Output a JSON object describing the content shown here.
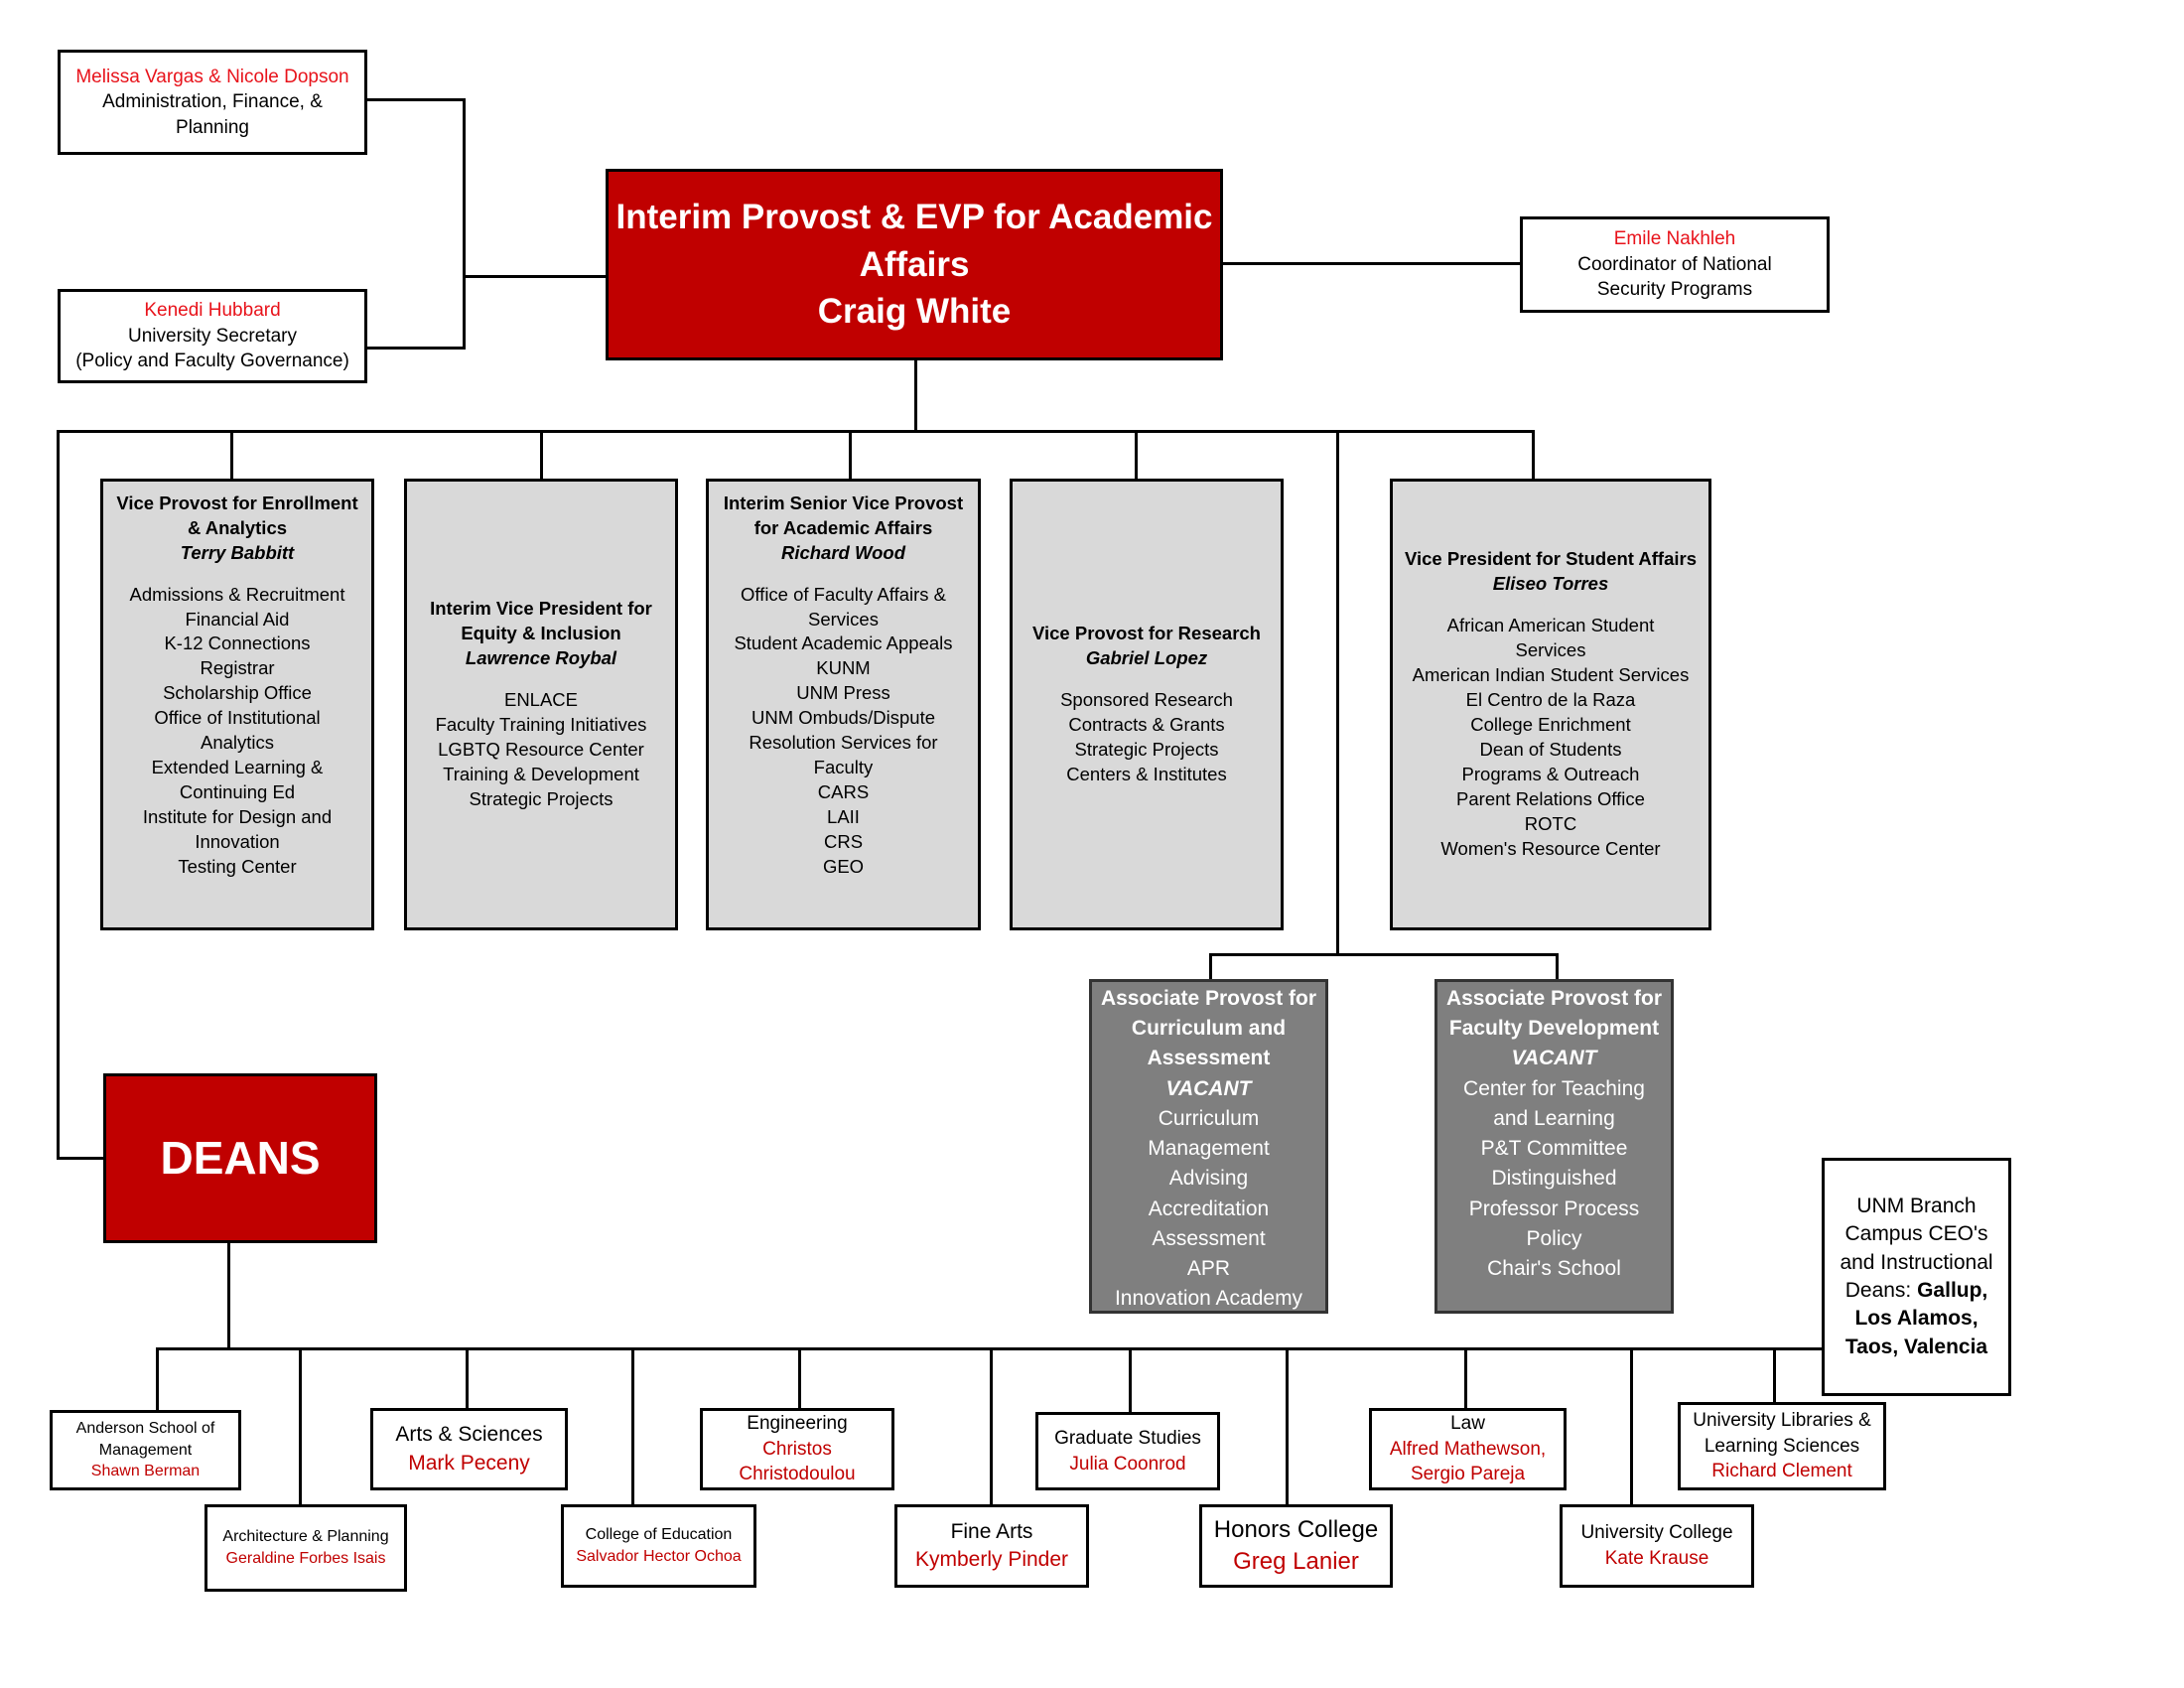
{
  "boxes": {
    "admin": {
      "lines": [
        {
          "t": "Melissa Vargas & Nicole Dopson",
          "s": "red"
        },
        {
          "t": "Administration, Finance, &",
          "s": ""
        },
        {
          "t": "Planning",
          "s": ""
        }
      ]
    },
    "secretary": {
      "lines": [
        {
          "t": "Kenedi Hubbard",
          "s": "red"
        },
        {
          "t": "University Secretary",
          "s": ""
        },
        {
          "t": "(Policy and Faculty Governance)",
          "s": ""
        }
      ]
    },
    "provost": {
      "lines": [
        {
          "t": "Interim Provost & EVP for Academic",
          "s": ""
        },
        {
          "t": "Affairs",
          "s": ""
        },
        {
          "t": "Craig White",
          "s": ""
        }
      ]
    },
    "security": {
      "lines": [
        {
          "t": "Emile Nakhleh",
          "s": "red"
        },
        {
          "t": "Coordinator of National",
          "s": ""
        },
        {
          "t": "Security Programs",
          "s": ""
        }
      ]
    },
    "enrollment": {
      "lines": [
        {
          "t": "Vice Provost for Enrollment",
          "s": "b"
        },
        {
          "t": "& Analytics",
          "s": "b"
        },
        {
          "t": "Terry Babbitt",
          "s": "bi"
        },
        {
          "t": "",
          "s": "blank"
        },
        {
          "t": "Admissions & Recruitment",
          "s": ""
        },
        {
          "t": "Financial Aid",
          "s": ""
        },
        {
          "t": "K-12 Connections",
          "s": ""
        },
        {
          "t": "Registrar",
          "s": ""
        },
        {
          "t": "Scholarship Office",
          "s": ""
        },
        {
          "t": "Office of Institutional",
          "s": ""
        },
        {
          "t": "Analytics",
          "s": ""
        },
        {
          "t": "Extended Learning &",
          "s": ""
        },
        {
          "t": "Continuing Ed",
          "s": ""
        },
        {
          "t": "Institute for Design and",
          "s": ""
        },
        {
          "t": "Innovation",
          "s": ""
        },
        {
          "t": "Testing Center",
          "s": ""
        }
      ]
    },
    "equity": {
      "lines": [
        {
          "t": "Interim Vice President for",
          "s": "b"
        },
        {
          "t": "Equity & Inclusion",
          "s": "b"
        },
        {
          "t": "Lawrence Roybal",
          "s": "bi"
        },
        {
          "t": "",
          "s": "blank"
        },
        {
          "t": "ENLACE",
          "s": ""
        },
        {
          "t": "Faculty Training Initiatives",
          "s": ""
        },
        {
          "t": "LGBTQ Resource Center",
          "s": ""
        },
        {
          "t": "Training & Development",
          "s": ""
        },
        {
          "t": "Strategic Projects",
          "s": ""
        }
      ]
    },
    "senior": {
      "lines": [
        {
          "t": "Interim Senior Vice Provost",
          "s": "b"
        },
        {
          "t": "for Academic Affairs",
          "s": "b"
        },
        {
          "t": "Richard Wood",
          "s": "bi"
        },
        {
          "t": "",
          "s": "blank"
        },
        {
          "t": "Office of Faculty Affairs &",
          "s": ""
        },
        {
          "t": "Services",
          "s": ""
        },
        {
          "t": "Student Academic Appeals",
          "s": ""
        },
        {
          "t": "KUNM",
          "s": ""
        },
        {
          "t": "UNM Press",
          "s": ""
        },
        {
          "t": "UNM Ombuds/Dispute",
          "s": ""
        },
        {
          "t": "Resolution Services for",
          "s": ""
        },
        {
          "t": "Faculty",
          "s": ""
        },
        {
          "t": "CARS",
          "s": ""
        },
        {
          "t": "LAII",
          "s": ""
        },
        {
          "t": "CRS",
          "s": ""
        },
        {
          "t": "GEO",
          "s": ""
        }
      ]
    },
    "research": {
      "lines": [
        {
          "t": "Vice Provost for Research",
          "s": "b"
        },
        {
          "t": "Gabriel Lopez",
          "s": "bi"
        },
        {
          "t": "",
          "s": "blank"
        },
        {
          "t": "Sponsored Research",
          "s": ""
        },
        {
          "t": "Contracts & Grants",
          "s": ""
        },
        {
          "t": "Strategic Projects",
          "s": ""
        },
        {
          "t": "Centers & Institutes",
          "s": ""
        }
      ]
    },
    "student_affairs": {
      "lines": [
        {
          "t": "Vice President for Student Affairs",
          "s": "b"
        },
        {
          "t": "Eliseo Torres",
          "s": "bi"
        },
        {
          "t": "",
          "s": "blank"
        },
        {
          "t": "African American Student",
          "s": ""
        },
        {
          "t": "Services",
          "s": ""
        },
        {
          "t": "American Indian Student Services",
          "s": ""
        },
        {
          "t": "El Centro de la Raza",
          "s": ""
        },
        {
          "t": "College Enrichment",
          "s": ""
        },
        {
          "t": "Dean of Students",
          "s": ""
        },
        {
          "t": "Programs & Outreach",
          "s": ""
        },
        {
          "t": "Parent Relations Office",
          "s": ""
        },
        {
          "t": "ROTC",
          "s": ""
        },
        {
          "t": "Women's Resource Center",
          "s": ""
        }
      ]
    },
    "curriculum": {
      "lines": [
        {
          "t": "Associate Provost for",
          "s": "b"
        },
        {
          "t": "Curriculum and",
          "s": "b"
        },
        {
          "t": "Assessment",
          "s": "b"
        },
        {
          "t": "VACANT",
          "s": "bi"
        },
        {
          "t": "Curriculum",
          "s": ""
        },
        {
          "t": "Management",
          "s": ""
        },
        {
          "t": "Advising",
          "s": ""
        },
        {
          "t": "Accreditation",
          "s": ""
        },
        {
          "t": "Assessment",
          "s": ""
        },
        {
          "t": "APR",
          "s": ""
        },
        {
          "t": "Innovation Academy",
          "s": ""
        }
      ]
    },
    "faculty_dev": {
      "lines": [
        {
          "t": "Associate Provost for",
          "s": "b"
        },
        {
          "t": "Faculty Development",
          "s": "b"
        },
        {
          "t": "VACANT",
          "s": "bi"
        },
        {
          "t": "Center for Teaching",
          "s": ""
        },
        {
          "t": "and Learning",
          "s": ""
        },
        {
          "t": "P&T Committee",
          "s": ""
        },
        {
          "t": "Distinguished",
          "s": ""
        },
        {
          "t": "Professor Process",
          "s": ""
        },
        {
          "t": "Policy",
          "s": ""
        },
        {
          "t": "Chair's School",
          "s": ""
        }
      ]
    },
    "deans": {
      "lines": [
        {
          "t": "DEANS",
          "s": ""
        }
      ]
    },
    "branch": {
      "lines": [
        {
          "t": "UNM Branch",
          "s": ""
        },
        {
          "t": "Campus CEO's",
          "s": ""
        },
        {
          "t": "and Instructional",
          "s": ""
        },
        {
          "t": "Deans: Gallup,",
          "s": ""
        },
        {
          "t": "Los Alamos,",
          "s": "b"
        },
        {
          "t": "Taos, Valencia",
          "s": "b"
        }
      ]
    },
    "anderson": {
      "lines": [
        {
          "t": "Anderson School of",
          "s": ""
        },
        {
          "t": "Management",
          "s": ""
        },
        {
          "t": "Shawn Berman",
          "s": "darkred"
        }
      ]
    },
    "architecture": {
      "lines": [
        {
          "t": "Architecture & Planning",
          "s": ""
        },
        {
          "t": "Geraldine Forbes Isais",
          "s": "darkred"
        }
      ]
    },
    "arts_sciences": {
      "lines": [
        {
          "t": "Arts & Sciences",
          "s": ""
        },
        {
          "t": "Mark Peceny",
          "s": "darkred"
        }
      ]
    },
    "education": {
      "lines": [
        {
          "t": "College of Education",
          "s": ""
        },
        {
          "t": "Salvador Hector Ochoa",
          "s": "darkred"
        }
      ]
    },
    "engineering": {
      "lines": [
        {
          "t": "Engineering",
          "s": ""
        },
        {
          "t": "Christos",
          "s": "darkred"
        },
        {
          "t": "Christodoulou",
          "s": "darkred"
        }
      ]
    },
    "fine_arts": {
      "lines": [
        {
          "t": "Fine Arts",
          "s": ""
        },
        {
          "t": "Kymberly Pinder",
          "s": "darkred"
        }
      ]
    },
    "graduate": {
      "lines": [
        {
          "t": "Graduate Studies",
          "s": ""
        },
        {
          "t": "Julia Coonrod",
          "s": "darkred"
        }
      ]
    },
    "honors": {
      "lines": [
        {
          "t": "Honors College",
          "s": ""
        },
        {
          "t": "Greg Lanier",
          "s": "darkred"
        }
      ]
    },
    "law": {
      "lines": [
        {
          "t": "Law",
          "s": ""
        },
        {
          "t": "Alfred Mathewson,",
          "s": "darkred"
        },
        {
          "t": "Sergio Pareja",
          "s": "darkred"
        }
      ]
    },
    "university_college": {
      "lines": [
        {
          "t": "University College",
          "s": ""
        },
        {
          "t": "Kate Krause",
          "s": "darkred"
        }
      ]
    },
    "libraries": {
      "lines": [
        {
          "t": "University Libraries &",
          "s": ""
        },
        {
          "t": "Learning Sciences",
          "s": ""
        },
        {
          "t": "Richard Clement",
          "s": "darkred"
        }
      ]
    }
  },
  "colors": {
    "leadership_red": "#c00000",
    "unit_gray": "#d9d9d9",
    "associate_gray": "#7f7f7f",
    "name_red": "#e8131b"
  }
}
